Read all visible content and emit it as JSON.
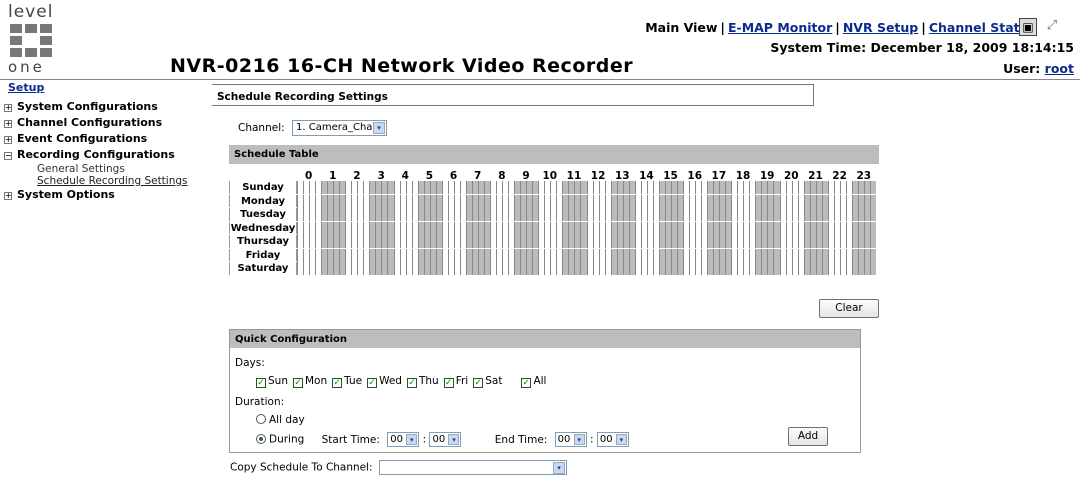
{
  "logo": {
    "top_text": "level",
    "bottom_text": "one"
  },
  "header": {
    "nav": [
      "Main View",
      "E-MAP Monitor",
      "NVR Setup",
      "Channel Status"
    ],
    "system_time": "System Time: December 18, 2009 18:14:15",
    "title": "NVR-0216 16-CH Network Video Recorder",
    "user_label": "User:",
    "user_name": "root"
  },
  "sidebar": {
    "setup": "Setup",
    "items": [
      {
        "label": "System Configurations",
        "expanded": false
      },
      {
        "label": "Channel Configurations",
        "expanded": false
      },
      {
        "label": "Event Configurations",
        "expanded": false
      },
      {
        "label": "Recording Configurations",
        "expanded": true
      },
      {
        "label": "System Options",
        "expanded": false
      }
    ],
    "sub_items": [
      "General Settings",
      "Schedule Recording Settings"
    ]
  },
  "page": {
    "title": "Schedule Recording Settings",
    "channel_label": "Channel:",
    "channel_value": "1. Camera_Cha",
    "schedule_table_title": "Schedule Table",
    "hours": [
      "0",
      "1",
      "2",
      "3",
      "4",
      "5",
      "6",
      "7",
      "8",
      "9",
      "10",
      "11",
      "12",
      "13",
      "14",
      "15",
      "16",
      "17",
      "18",
      "19",
      "20",
      "21",
      "22",
      "23"
    ],
    "days": [
      "Sunday",
      "Monday",
      "Tuesday",
      "Wednesday",
      "Thursday",
      "Friday",
      "Saturday"
    ],
    "clear_label": "Clear"
  },
  "quick": {
    "title": "Quick Configuration",
    "days_label": "Days:",
    "day_checks": [
      "Sun",
      "Mon",
      "Tue",
      "Wed",
      "Thu",
      "Fri",
      "Sat",
      "All"
    ],
    "duration_label": "Duration:",
    "allday_label": "All day",
    "during_label": "During",
    "start_label": "Start Time:",
    "end_label": "End Time:",
    "start_h": "00",
    "start_m": "00",
    "end_h": "00",
    "end_m": "00",
    "colon": ":",
    "add_label": "Add"
  },
  "copy": {
    "label": "Copy Schedule To Channel:"
  },
  "icons": {
    "pm_plus": "+",
    "pm_minus": "−",
    "check": "✓",
    "dropdown": "▾",
    "win_a": "▣",
    "win_b": "⤢"
  }
}
